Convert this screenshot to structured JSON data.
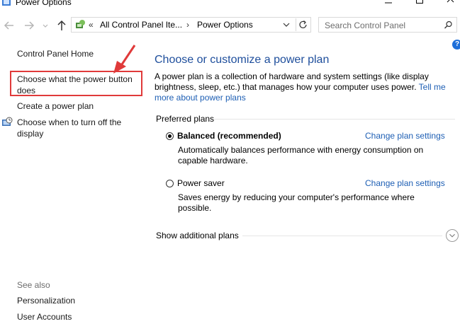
{
  "window": {
    "title": "Power Options"
  },
  "addressbar": {
    "overflow": "«",
    "crumbs": [
      "All Control Panel Ite...",
      "Power Options"
    ],
    "separator": "›"
  },
  "search": {
    "placeholder": "Search Control Panel"
  },
  "sidebar": {
    "items": [
      {
        "label": "Control Panel Home"
      },
      {
        "label": "Choose what the power button does"
      },
      {
        "label": "Create a power plan"
      },
      {
        "label": "Choose when to turn off the display"
      }
    ],
    "see_also": {
      "heading": "See also",
      "items": [
        {
          "label": "Personalization"
        },
        {
          "label": "User Accounts"
        }
      ]
    }
  },
  "help": {
    "glyph": "?"
  },
  "main": {
    "title": "Choose or customize a power plan",
    "description": "A power plan is a collection of hardware and system settings (like display brightness, sleep, etc.) that manages how your computer uses power.",
    "description_link": "Tell me more about power plans",
    "preferred_heading": "Preferred plans",
    "plans": [
      {
        "name": "Balanced (recommended)",
        "selected": true,
        "link": "Change plan settings",
        "description": "Automatically balances performance with energy consumption on capable hardware."
      },
      {
        "name": "Power saver",
        "selected": false,
        "link": "Change plan settings",
        "description": "Saves energy by reducing your computer's performance where possible."
      }
    ],
    "show_more": "Show additional plans"
  },
  "colors": {
    "link": "#1e5fb4",
    "title": "#1e4e9c",
    "highlight": "#e03a3a"
  }
}
